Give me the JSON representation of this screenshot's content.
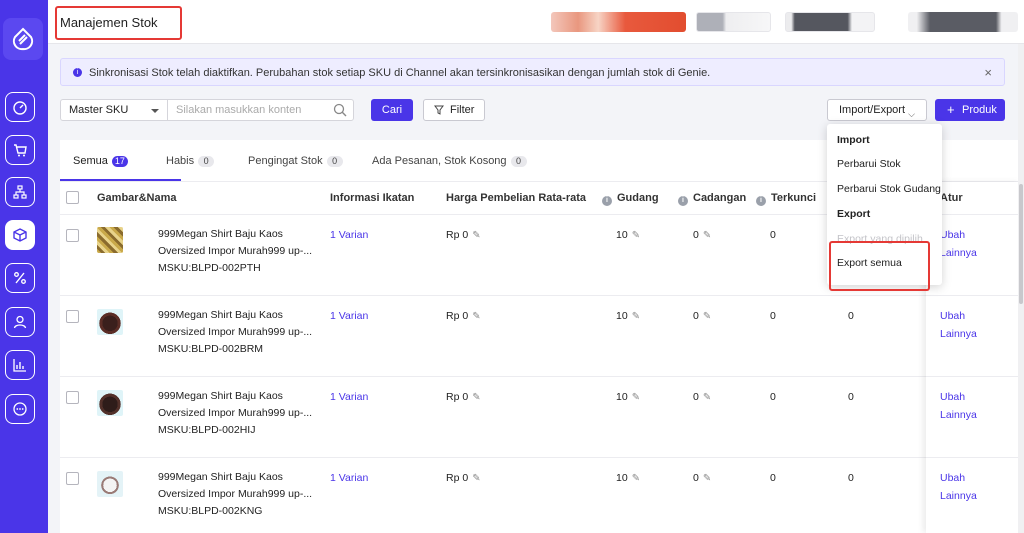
{
  "colors": {
    "brand": "#4a35e8",
    "highlight": "#e53935"
  },
  "header": {
    "title": "Manajemen Stok"
  },
  "sidebar": {
    "items": [
      {
        "icon": "dashboard-icon"
      },
      {
        "icon": "cart-icon"
      },
      {
        "icon": "sitemap-icon"
      },
      {
        "icon": "box-icon",
        "active": true
      },
      {
        "icon": "percent-icon"
      },
      {
        "icon": "user-icon"
      },
      {
        "icon": "chart-icon"
      },
      {
        "icon": "chat-icon"
      }
    ]
  },
  "notice": {
    "message": "Sinkronisasi Stok telah diaktifkan. Perubahan stok setiap SKU di Channel akan tersinkronisasikan dengan jumlah stok di Genie.",
    "close": "×"
  },
  "toolbar": {
    "sku_select": "Master SKU",
    "search_placeholder": "Silakan masukkan konten",
    "search_button": "Cari",
    "filter_button": "Filter",
    "import_export_button": "Import/Export",
    "add_product_button": "Produk",
    "add_plus": "+"
  },
  "tabs": [
    {
      "label": "Semua",
      "count": "17"
    },
    {
      "label": "Habis",
      "count": "0"
    },
    {
      "label": "Pengingat Stok",
      "count": "0"
    },
    {
      "label": "Ada Pesanan, Stok Kosong",
      "count": "0"
    }
  ],
  "table": {
    "headers": {
      "image_name": "Gambar&Nama",
      "binding": "Informasi Ikatan",
      "avg_price": "Harga Pembelian Rata-rata",
      "warehouse": "Gudang",
      "reserve": "Cadangan",
      "locked": "Terkunci",
      "actions": "Atur"
    },
    "rows": [
      {
        "name_line1": "999Megan Shirt Baju Kaos",
        "name_line2": "Oversized Impor Murah999 up-...",
        "msku": "MSKU:BLPD-002PTH",
        "binding": "1 Varian",
        "price": "Rp 0",
        "warehouse": "10",
        "reserve": "0",
        "locked": "0",
        "extra": "",
        "edit": "Ubah",
        "more": "Lainnya"
      },
      {
        "name_line1": "999Megan Shirt Baju Kaos",
        "name_line2": "Oversized Impor Murah999 up-...",
        "msku": "MSKU:BLPD-002BRM",
        "binding": "1 Varian",
        "price": "Rp 0",
        "warehouse": "10",
        "reserve": "0",
        "locked": "0",
        "extra": "0",
        "edit": "Ubah",
        "more": "Lainnya"
      },
      {
        "name_line1": "999Megan Shirt Baju Kaos",
        "name_line2": "Oversized Impor Murah999 up-...",
        "msku": "MSKU:BLPD-002HIJ",
        "binding": "1 Varian",
        "price": "Rp 0",
        "warehouse": "10",
        "reserve": "0",
        "locked": "0",
        "extra": "0",
        "edit": "Ubah",
        "more": "Lainnya"
      },
      {
        "name_line1": "999Megan Shirt Baju Kaos",
        "name_line2": "Oversized Impor Murah999 up-...",
        "msku": "MSKU:BLPD-002KNG",
        "binding": "1 Varian",
        "price": "Rp 0",
        "warehouse": "10",
        "reserve": "0",
        "locked": "0",
        "extra": "0",
        "edit": "Ubah",
        "more": "Lainnya"
      }
    ]
  },
  "dropdown": {
    "import_head": "Import",
    "update_stock": "Perbarui Stok",
    "update_warehouse_stock": "Perbarui Stok Gudang",
    "export_head": "Export",
    "export_selected": "Export yang dipilih",
    "export_all": "Export semua"
  }
}
